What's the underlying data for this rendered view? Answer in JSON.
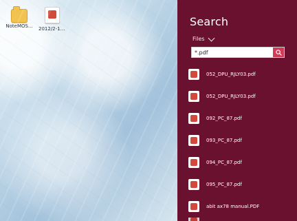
{
  "desktop": {
    "icons": [
      {
        "label": "NoteMOS..."
      },
      {
        "label": "2012/2-16..."
      }
    ]
  },
  "search_panel": {
    "title": "Search",
    "filter_label": "Files",
    "query": "*.pdf",
    "results": [
      {
        "name": "052_DPU_RJLY03.pdf"
      },
      {
        "name": "052_DPU_RJLY03.pdf"
      },
      {
        "name": "092_PC_87.pdf"
      },
      {
        "name": "093_PC_87.pdf"
      },
      {
        "name": "094_PC_87.pdf"
      },
      {
        "name": "095_PC_87.pdf"
      },
      {
        "name": "abit ax78 manual.PDF"
      }
    ],
    "partial_result": {
      "name": "..."
    }
  },
  "colors": {
    "charm_background": "#6b1130",
    "search_button": "#d23b55",
    "pdf_red": "#d24a3b"
  },
  "icons": {
    "folder": "folder-icon",
    "pdf": "pdf-icon",
    "search": "search-icon",
    "chevron": "chevron-down-icon"
  }
}
